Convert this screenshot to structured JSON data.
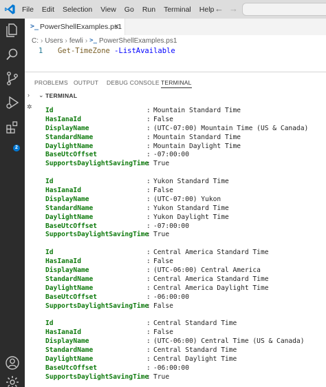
{
  "menu": [
    "File",
    "Edit",
    "Selection",
    "View",
    "Go",
    "Run",
    "Terminal",
    "Help"
  ],
  "nav": {
    "back": "←",
    "forward": "→"
  },
  "activity": {
    "extensions_badge": "2"
  },
  "editor": {
    "tab_label": "PowerShellExamples.ps1",
    "tab_close": "×",
    "breadcrumb": [
      "C:",
      "Users",
      "fewli",
      "PowerShellExamples.ps1"
    ],
    "line_number": "1",
    "code_cmd": "Get-TimeZone",
    "code_param": " -ListAvailable"
  },
  "panel": {
    "tabs": [
      "PROBLEMS",
      "OUTPUT",
      "DEBUG CONSOLE",
      "TERMINAL"
    ],
    "active_tab": "TERMINAL",
    "section_title": "TERMINAL"
  },
  "terminal": {
    "records": [
      {
        "Id": "Mountain Standard Time",
        "HasIanaId": "False",
        "DisplayName": "(UTC-07:00) Mountain Time (US & Canada)",
        "StandardName": "Mountain Standard Time",
        "DaylightName": "Mountain Daylight Time",
        "BaseUtcOffset": "-07:00:00",
        "SupportsDaylightSavingTime": "True"
      },
      {
        "Id": "Yukon Standard Time",
        "HasIanaId": "False",
        "DisplayName": "(UTC-07:00) Yukon",
        "StandardName": "Yukon Standard Time",
        "DaylightName": "Yukon Daylight Time",
        "BaseUtcOffset": "-07:00:00",
        "SupportsDaylightSavingTime": "True"
      },
      {
        "Id": "Central America Standard Time",
        "HasIanaId": "False",
        "DisplayName": "(UTC-06:00) Central America",
        "StandardName": "Central America Standard Time",
        "DaylightName": "Central America Daylight Time",
        "BaseUtcOffset": "-06:00:00",
        "SupportsDaylightSavingTime": "False"
      },
      {
        "Id": "Central Standard Time",
        "HasIanaId": "False",
        "DisplayName": "(UTC-06:00) Central Time (US & Canada)",
        "StandardName": "Central Standard Time",
        "DaylightName": "Central Daylight Time",
        "BaseUtcOffset": "-06:00:00",
        "SupportsDaylightSavingTime": "True"
      }
    ],
    "field_order": [
      "Id",
      "HasIanaId",
      "DisplayName",
      "StandardName",
      "DaylightName",
      "BaseUtcOffset",
      "SupportsDaylightSavingTime"
    ],
    "separator": ":"
  },
  "colors": {
    "accent": "#0078d4",
    "key_green": "#0e7a0d",
    "activity_bar": "#2c2c2c"
  }
}
